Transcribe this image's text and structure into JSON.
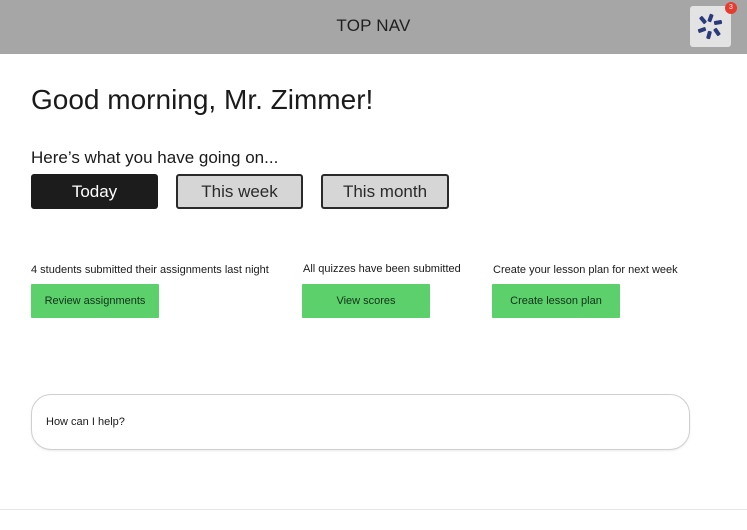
{
  "nav": {
    "title": "TOP NAV",
    "badge_count": "3",
    "logo_icon": "brand-logo-icon",
    "logo_color": "#2b3a7a",
    "badge_color": "#e63b2e"
  },
  "greeting": "Good morning, Mr. Zimmer!",
  "subheading": "Here’s what you have going on...",
  "tabs": [
    {
      "label": "Today",
      "active": true
    },
    {
      "label": "This week",
      "active": false
    },
    {
      "label": "This month",
      "active": false
    }
  ],
  "cards": [
    {
      "text": "4 students submitted their assignments last night",
      "button": "Review assignments"
    },
    {
      "text": "All quizzes have been submitted",
      "button": "View scores"
    },
    {
      "text": "Create your lesson plan for next week",
      "button": "Create lesson plan"
    }
  ],
  "help": {
    "placeholder": "How can I help?"
  },
  "colors": {
    "accent_green": "#5cd06a",
    "nav_gray": "#a6a6a6",
    "active_tab": "#1c1c1c"
  }
}
